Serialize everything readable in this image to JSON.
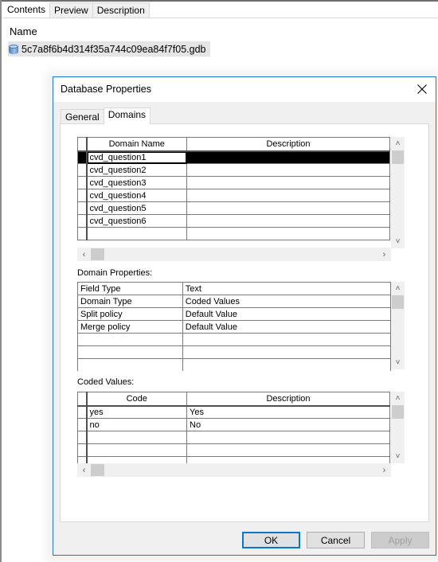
{
  "catalog": {
    "tabs": [
      {
        "label": "Contents",
        "active": true
      },
      {
        "label": "Preview",
        "active": false
      },
      {
        "label": "Description",
        "active": false
      }
    ],
    "column_header": "Name",
    "items": [
      {
        "label": "5c7a8f6b4d314f35a744c09ea84f7f05.gdb",
        "icon": "geodatabase-icon"
      }
    ]
  },
  "dialog": {
    "title": "Database Properties",
    "close_icon": "close-icon",
    "tabs": [
      {
        "label": "General",
        "active": false
      },
      {
        "label": "Domains",
        "active": true
      }
    ],
    "domains_grid": {
      "columns": [
        "Domain Name",
        "Description"
      ],
      "rows": [
        {
          "name": "cvd_question1",
          "description": "",
          "selected": true
        },
        {
          "name": "cvd_question2",
          "description": ""
        },
        {
          "name": "cvd_question3",
          "description": ""
        },
        {
          "name": "cvd_question4",
          "description": ""
        },
        {
          "name": "cvd_question5",
          "description": ""
        },
        {
          "name": "cvd_question6",
          "description": ""
        },
        {
          "name": "",
          "description": ""
        },
        {
          "name": "",
          "description": ""
        }
      ]
    },
    "domain_properties": {
      "label": "Domain Properties:",
      "rows": [
        {
          "property": "Field Type",
          "value": "Text"
        },
        {
          "property": "Domain Type",
          "value": "Coded Values"
        },
        {
          "property": "Split policy",
          "value": "Default Value"
        },
        {
          "property": "Merge policy",
          "value": "Default Value"
        },
        {
          "property": "",
          "value": ""
        },
        {
          "property": "",
          "value": ""
        },
        {
          "property": "",
          "value": ""
        }
      ]
    },
    "coded_values": {
      "label": "Coded Values:",
      "columns": [
        "Code",
        "Description"
      ],
      "rows": [
        {
          "code": "yes",
          "description": "Yes"
        },
        {
          "code": "no",
          "description": "No"
        },
        {
          "code": "",
          "description": ""
        },
        {
          "code": "",
          "description": ""
        },
        {
          "code": "",
          "description": ""
        }
      ]
    },
    "buttons": {
      "ok": "OK",
      "cancel": "Cancel",
      "apply": "Apply"
    }
  }
}
